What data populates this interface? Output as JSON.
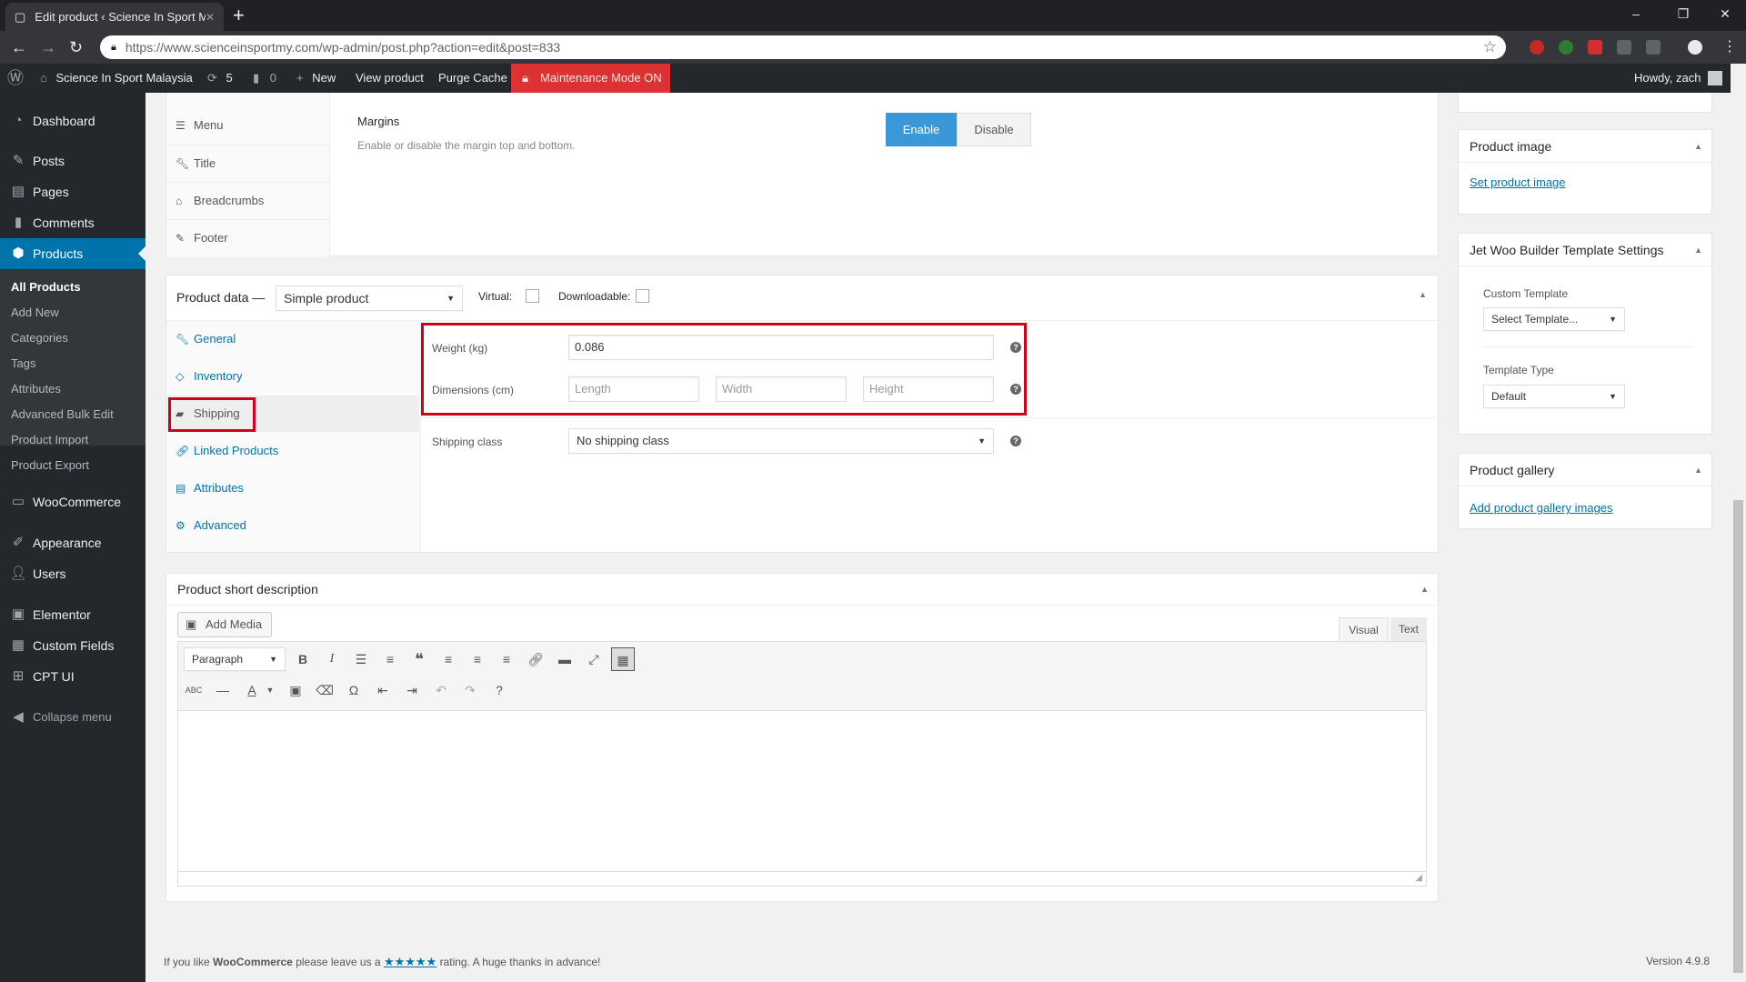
{
  "browser": {
    "tab_title": "Edit product ‹ Science In Sport M",
    "new_tab": "+",
    "url_scheme": "https://",
    "url": "https://www.scienceinsportmy.com/wp-admin/post.php?action=edit&post=833",
    "window_controls": {
      "minimize": "–",
      "restore": "❐",
      "close": "✕"
    }
  },
  "adminbar": {
    "site_name": "Science In Sport Malaysia",
    "updates_count": "5",
    "comments_count": "0",
    "new_label": "New",
    "view_product": "View product",
    "purge_cache": "Purge Cache",
    "maintenance": "Maintenance Mode ON",
    "howdy": "Howdy, zach"
  },
  "sidebar": {
    "items": [
      {
        "label": "Dashboard",
        "icon": "dashboard-icon"
      },
      {
        "label": "Posts",
        "icon": "pin-icon"
      },
      {
        "label": "Pages",
        "icon": "pages-icon"
      },
      {
        "label": "Comments",
        "icon": "comment-icon"
      },
      {
        "label": "Products",
        "icon": "box-icon"
      },
      {
        "label": "WooCommerce",
        "icon": "woo-icon"
      },
      {
        "label": "Appearance",
        "icon": "brush-icon"
      },
      {
        "label": "Users",
        "icon": "user-icon"
      },
      {
        "label": "Elementor",
        "icon": "elementor-icon"
      },
      {
        "label": "Custom Fields",
        "icon": "table-icon"
      },
      {
        "label": "CPT UI",
        "icon": "grid-icon"
      },
      {
        "label": "Collapse menu",
        "icon": "collapse-icon"
      }
    ],
    "submenu": [
      "All Products",
      "Add New",
      "Categories",
      "Tags",
      "Attributes",
      "Advanced Bulk Edit",
      "Product Import",
      "Product Export"
    ]
  },
  "settings_panel": {
    "tabs": [
      "Menu",
      "Title",
      "Breadcrumbs",
      "Footer"
    ],
    "margins_label": "Margins",
    "margins_desc": "Enable or disable the margin top and bottom.",
    "enable": "Enable",
    "disable": "Disable"
  },
  "product_data": {
    "title": "Product data —",
    "type": "Simple product",
    "virtual": "Virtual:",
    "downloadable": "Downloadable:",
    "tabs": [
      "General",
      "Inventory",
      "Shipping",
      "Linked Products",
      "Attributes",
      "Advanced"
    ],
    "weight_label": "Weight (kg)",
    "weight_value": "0.086",
    "dimensions_label": "Dimensions (cm)",
    "length_ph": "Length",
    "width_ph": "Width",
    "height_ph": "Height",
    "shipping_class_label": "Shipping class",
    "shipping_class_value": "No shipping class",
    "highlight_color": "#d0021b"
  },
  "short_desc": {
    "title": "Product short description",
    "add_media": "Add Media",
    "visual": "Visual",
    "text": "Text",
    "format": "Paragraph"
  },
  "right_col": {
    "product_image_title": "Product image",
    "set_image": "Set product image",
    "jet_title": "Jet Woo Builder Template Settings",
    "custom_template_label": "Custom Template",
    "custom_template_value": "Select Template...",
    "template_type_label": "Template Type",
    "template_type_value": "Default",
    "gallery_title": "Product gallery",
    "add_gallery": "Add product gallery images"
  },
  "footer": {
    "left_prefix": "If you like",
    "brand": "WooCommerce",
    "mid": "please leave us a",
    "stars": "★★★★★",
    "suffix": "rating. A huge thanks in advance!",
    "version": "Version 4.9.8"
  }
}
